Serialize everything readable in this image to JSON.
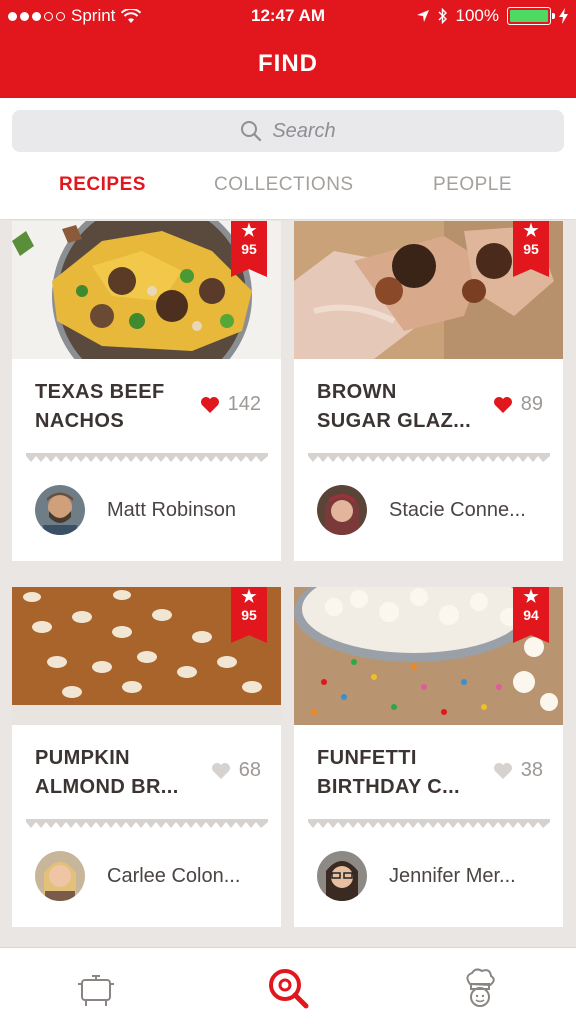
{
  "status_bar": {
    "carrier": "Sprint",
    "time": "12:47 AM",
    "battery": "100%"
  },
  "header": {
    "title": "FIND"
  },
  "search": {
    "placeholder": "Search"
  },
  "tabs": [
    {
      "label": "RECIPES",
      "active": true
    },
    {
      "label": "COLLECTIONS",
      "active": false
    },
    {
      "label": "PEOPLE",
      "active": false
    }
  ],
  "recipes": [
    {
      "title": "TEXAS BEEF\nNACHOS",
      "score": "95",
      "likes": "142",
      "liked": true,
      "author": "Matt Robinson"
    },
    {
      "title": "BROWN\nSUGAR GLAZ...",
      "score": "95",
      "likes": "89",
      "liked": true,
      "author": "Stacie Conne..."
    },
    {
      "title": "PUMPKIN\nALMOND BR...",
      "score": "95",
      "likes": "68",
      "liked": false,
      "author": "Carlee Colon..."
    },
    {
      "title": "FUNFETTI\nBIRTHDAY C...",
      "score": "94",
      "likes": "38",
      "liked": false,
      "author": "Jennifer Mer..."
    }
  ],
  "colors": {
    "brand": "#e2171e",
    "liked_heart": "#e2171e",
    "unliked_heart": "#d6d2cf",
    "battery": "#4cd964"
  },
  "tab_bar": [
    {
      "icon": "cooking-pot-icon",
      "active": false
    },
    {
      "icon": "find-search-icon",
      "active": true
    },
    {
      "icon": "chef-profile-icon",
      "active": false
    }
  ]
}
